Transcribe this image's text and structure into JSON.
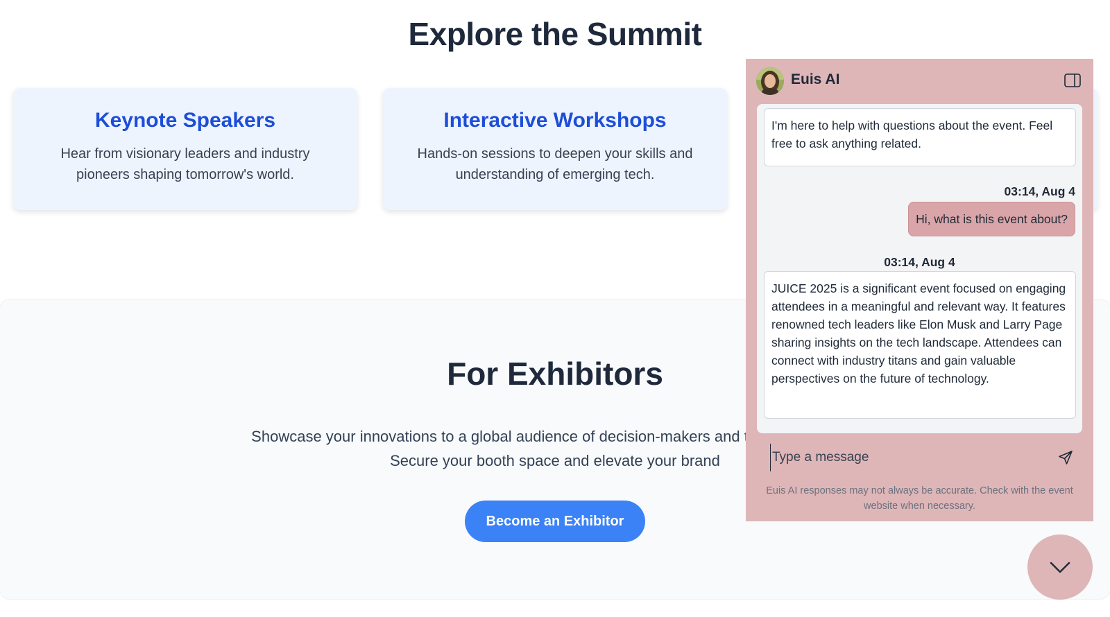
{
  "summit": {
    "title": "Explore the Summit",
    "cards": [
      {
        "title": "Keynote Speakers",
        "description": "Hear from visionary leaders and industry pioneers shaping tomorrow's world."
      },
      {
        "title": "Interactive Workshops",
        "description": "Hands-on sessions to deepen your skills and understanding of emerging tech."
      },
      {
        "title": "",
        "description": ""
      }
    ]
  },
  "exhibitors": {
    "title": "For Exhibitors",
    "description": "Showcase your innovations to a global audience of decision-makers and tech enthusiasts. Secure your booth space and elevate your brand",
    "button_label": "Become an Exhibitor"
  },
  "chat": {
    "name": "Euis AI",
    "messages": {
      "bot_1": "I'm here to help with questions about the event. Feel free to ask anything related.",
      "user_time": "03:14, Aug 4",
      "user_1": "Hi, what is this event about?",
      "bot_time": "03:14, Aug 4",
      "bot_2": "JUICE 2025 is a significant event focused on engaging attendees in a meaningful and relevant way. It features renowned tech leaders like Elon Musk and Larry Page sharing insights on the tech landscape. Attendees can connect with industry titans and gain valuable perspectives on the future of technology."
    },
    "input": {
      "placeholder": "Type a message",
      "value": ""
    },
    "disclaimer": "Euis AI responses may not always be accurate. Check with the event website when necessary.",
    "icons": {
      "panel": "sidebar-panel-icon",
      "send": "send-icon",
      "toggle": "chevron-down-icon"
    }
  },
  "colors": {
    "accent_blue": "#3b82f6",
    "card_title_blue": "#1d4ed8",
    "chat_bg": "#deb6b7",
    "user_bubble": "#d9a5a8"
  }
}
